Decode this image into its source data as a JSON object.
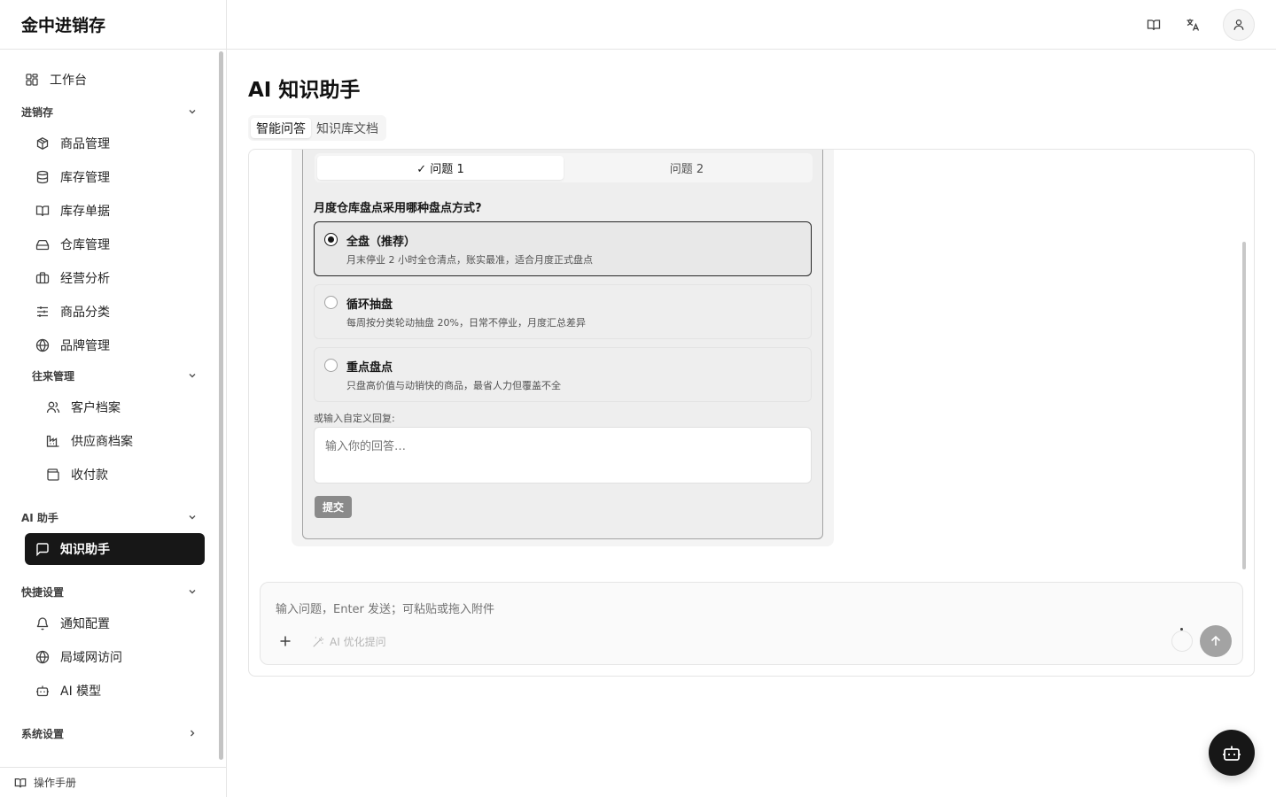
{
  "app": {
    "brand": "金中进销存"
  },
  "sidebar": {
    "workbench": "工作台",
    "groups": {
      "inventory": "进销存",
      "contacts": "往来管理",
      "ai": "AI 助手",
      "quick": "快捷设置",
      "system": "系统设置"
    },
    "items": {
      "products": "商品管理",
      "stock": "库存管理",
      "stock_docs": "库存单据",
      "warehouse": "仓库管理",
      "analysis": "经营分析",
      "categories": "商品分类",
      "brands": "品牌管理",
      "customers": "客户档案",
      "suppliers": "供应商档案",
      "payments": "收付款",
      "knowledge": "知识助手",
      "notify": "通知配置",
      "lan": "局域网访问",
      "ai_model": "AI 模型"
    },
    "footer": "操作手册"
  },
  "main": {
    "title": "AI 知识助手",
    "tabs": [
      "智能问答",
      "知识库文档"
    ]
  },
  "survey": {
    "tabs": [
      "✓ 问题 1",
      "问题 2"
    ],
    "question": "月度仓库盘点采用哪种盘点方式?",
    "options": [
      {
        "title": "全盘（推荐）",
        "desc": "月末停业 2 小时全仓清点，账实最准，适合月度正式盘点",
        "selected": true
      },
      {
        "title": "循环抽盘",
        "desc": "每周按分类轮动抽盘 20%，日常不停业，月度汇总差异",
        "selected": false
      },
      {
        "title": "重点盘点",
        "desc": "只盘高价值与动销快的商品，最省人力但覆盖不全",
        "selected": false
      }
    ],
    "custom_label": "或输入自定义回复:",
    "custom_placeholder": "输入你的回答…",
    "submit": "提交"
  },
  "composer": {
    "placeholder": "输入问题，Enter 发送；可粘贴或拖入附件",
    "optimize": "AI 优化提问"
  }
}
